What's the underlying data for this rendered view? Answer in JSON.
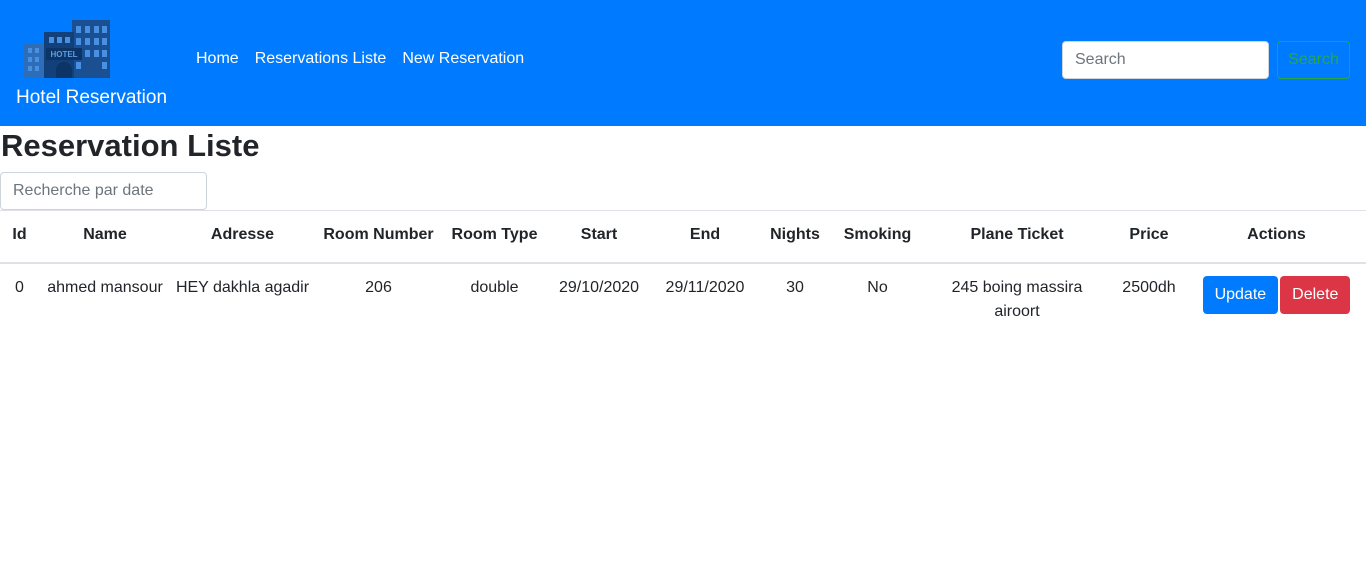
{
  "colors": {
    "navbar": "#007bff",
    "update": "#007bff",
    "delete": "#dc3545",
    "search_outline": "#28a745"
  },
  "brand": {
    "logo_icon": "hotel-building-icon",
    "logo_text": "HOTEL",
    "name": "Hotel Reservation"
  },
  "nav": {
    "links": [
      "Home",
      "Reservations Liste",
      "New Reservation"
    ]
  },
  "search": {
    "placeholder": "Search",
    "button_label": "Search"
  },
  "page": {
    "title": "Reservation Liste",
    "date_filter_placeholder": "Recherche par date"
  },
  "table": {
    "headers": [
      "Id",
      "Name",
      "Adresse",
      "Room Number",
      "Room Type",
      "Start",
      "End",
      "Nights",
      "Smoking",
      "Plane Ticket",
      "Price",
      "Actions"
    ],
    "rows": [
      {
        "id": "0",
        "name": "ahmed mansour",
        "adresse": "HEY dakhla agadir",
        "room_number": "206",
        "room_type": "double",
        "start": "29/10/2020",
        "end": "29/11/2020",
        "nights": "30",
        "smoking": "No",
        "plane_ticket": "245 boing massira airoort",
        "price": "2500dh",
        "actions": {
          "update": "Update",
          "delete": "Delete"
        }
      }
    ]
  }
}
